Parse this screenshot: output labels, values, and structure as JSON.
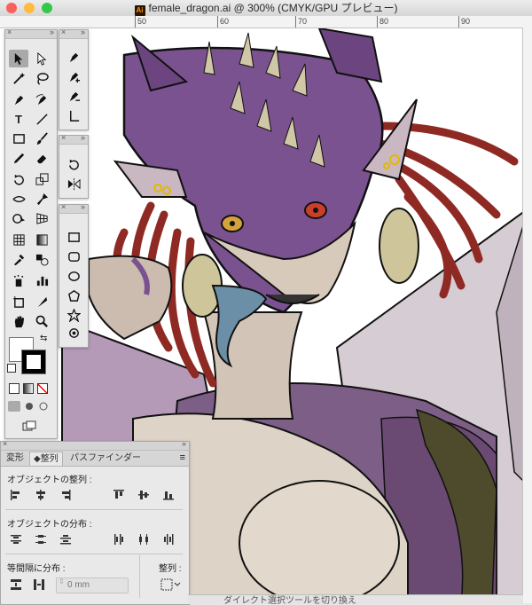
{
  "window": {
    "title": "female_dragon.ai @ 300% (CMYK/GPU プレビュー)",
    "icon_text": "Ai",
    "traffic_lights": [
      "#fc605c",
      "#fdbc40",
      "#34c84a"
    ]
  },
  "ruler": {
    "ticks": [
      "50",
      "60",
      "70",
      "80",
      "90"
    ]
  },
  "toolbar": {
    "tools": [
      "selection-tool",
      "direct-selection-tool",
      "magic-wand-tool",
      "lasso-tool",
      "pen-tool",
      "curvature-tool",
      "type-tool",
      "line-tool",
      "rectangle-tool",
      "paintbrush-tool",
      "pencil-tool",
      "eraser-tool",
      "rotate-tool",
      "scale-tool",
      "width-tool",
      "puppet-warp-tool",
      "shape-builder-tool",
      "perspective-grid-tool",
      "mesh-tool",
      "gradient-tool",
      "eyedropper-tool",
      "blend-tool",
      "symbol-sprayer-tool",
      "column-graph-tool",
      "artboard-tool",
      "slice-tool",
      "hand-tool",
      "zoom-tool"
    ],
    "fill_color": "#ffffff",
    "stroke_color": "#000000"
  },
  "pen_flyout": {
    "tools": [
      "pen-tool",
      "add-anchor-point-tool",
      "delete-anchor-point-tool",
      "anchor-point-tool"
    ]
  },
  "rotate_flyout": {
    "tools": [
      "rotate-tool",
      "reflect-tool"
    ]
  },
  "shape_flyout": {
    "tools": [
      "rectangle-tool",
      "rounded-rectangle-tool",
      "ellipse-tool",
      "polygon-tool",
      "star-tool",
      "flare-tool"
    ]
  },
  "align_panel": {
    "tabs": [
      "変形",
      "整列",
      "パスファインダー"
    ],
    "active_tab": "整列",
    "align_objects_label": "オブジェクトの整列 :",
    "distribute_objects_label": "オブジェクトの分布 :",
    "distribute_spacing_label": "等間隔に分布 :",
    "align_to_label": "整列 :",
    "spacing_placeholder": "0 mm"
  },
  "status_bar": {
    "text": "ダイレクト選択ツールを切り換え"
  },
  "colors": {
    "dragon_purple": "#7a4f8c",
    "hair_red": "#9a2a22",
    "skin": "#d8cbbd",
    "horn": "#cfc59a",
    "tongue": "#6b8fa6",
    "wing": "#c9c0c6"
  }
}
